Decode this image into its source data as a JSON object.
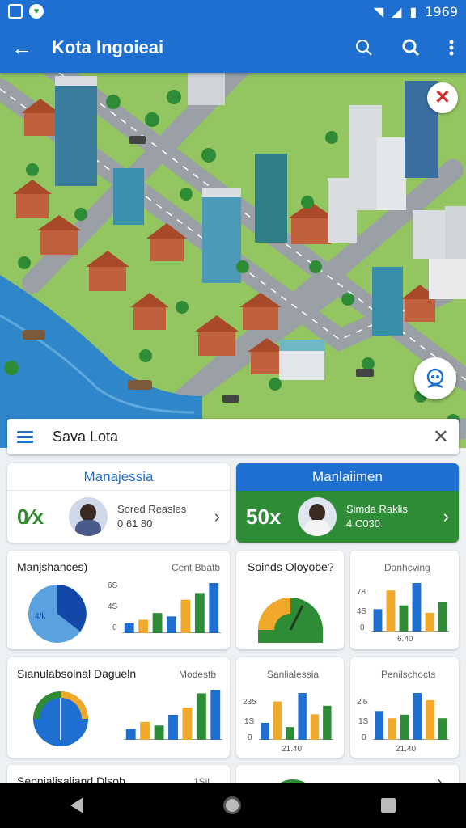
{
  "status": {
    "time": "1969"
  },
  "app_bar": {
    "title": "Kota Ingoieai",
    "back_icon": "arrow-left-icon",
    "actions": [
      "search-outline-icon",
      "search-icon",
      "more-vert-icon"
    ]
  },
  "map": {
    "close_icon": "close-icon",
    "fab_icon": "layers-icon"
  },
  "search": {
    "text": "Sava Lota",
    "menu_icon": "menu-icon",
    "close_icon": "close-icon"
  },
  "stats": [
    {
      "title": "Manajessia",
      "value": "0⁄x",
      "line1": "Sored Reasles",
      "line2": "0 61 80"
    },
    {
      "title": "Manlaiimen",
      "value": "50x",
      "line1": "Simda Raklis",
      "line2": "4 C030"
    }
  ],
  "charts": [
    {
      "title": "Manjshances)",
      "subtitle": "Cent Bbatb",
      "ticks": [
        "6S",
        "4S",
        "0"
      ],
      "pie_label": "4/k",
      "bars": [
        3,
        4,
        6,
        5,
        10,
        12,
        15
      ]
    },
    {
      "title": "Soinds Oloyobe?",
      "gauge": 0.62
    },
    {
      "title": "Danhcving",
      "ticks": [
        "78",
        "4S",
        "0"
      ],
      "footer": "6.40",
      "bars": [
        6,
        11,
        7,
        13,
        5,
        8
      ]
    },
    {
      "title": "Sianulabsolnal Dagueln",
      "subtitle": "Modestb",
      "donut": [
        0.5,
        0.25,
        0.25
      ],
      "bars": [
        3,
        5,
        4,
        7,
        9,
        13,
        14
      ]
    },
    {
      "title": "Sanlialessia",
      "ticks": [
        "235",
        "1S",
        "0"
      ],
      "footer": "21.40",
      "bars": [
        4,
        9,
        3,
        11,
        6,
        8
      ]
    },
    {
      "title": "Penilschocts",
      "ticks": [
        "2l6",
        "1S",
        "0"
      ],
      "footer": "21.40",
      "bars": [
        8,
        6,
        7,
        13,
        11,
        6
      ]
    },
    {
      "title": "Sepnialisaliand Dlsob",
      "subtitle": "1Sil"
    }
  ]
}
